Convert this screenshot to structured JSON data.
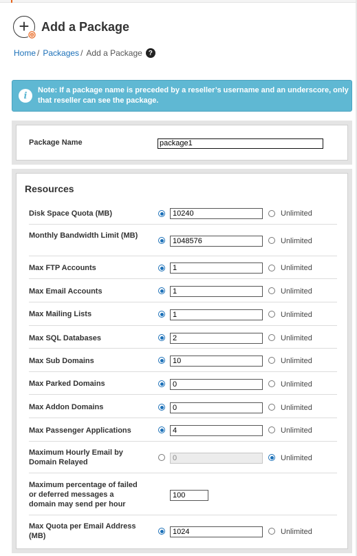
{
  "header": {
    "title": "Add a Package"
  },
  "breadcrumb": {
    "home": "Home",
    "sep": "/",
    "packages": "Packages",
    "current": "Add a Package",
    "help_glyph": "?"
  },
  "note": {
    "text": "Note: If a package name is preceded by a reseller’s username and an underscore, only that reseller can see the package."
  },
  "package": {
    "label": "Package Name",
    "value": "package1"
  },
  "resources": {
    "title": "Resources",
    "rows": [
      {
        "label": "Disk Space Quota (MB)",
        "value": "10240",
        "unlimited_label": "Unlimited",
        "selected": "value"
      },
      {
        "label": "Monthly Bandwidth Limit (MB)",
        "value": "1048576",
        "unlimited_label": "Unlimited",
        "selected": "value"
      },
      {
        "label": "Max FTP Accounts",
        "value": "1",
        "unlimited_label": "Unlimited",
        "selected": "value"
      },
      {
        "label": "Max Email Accounts",
        "value": "1",
        "unlimited_label": "Unlimited",
        "selected": "value"
      },
      {
        "label": "Max Mailing Lists",
        "value": "1",
        "unlimited_label": "Unlimited",
        "selected": "value"
      },
      {
        "label": "Max SQL Databases",
        "value": "2",
        "unlimited_label": "Unlimited",
        "selected": "value"
      },
      {
        "label": "Max Sub Domains",
        "value": "10",
        "unlimited_label": "Unlimited",
        "selected": "value"
      },
      {
        "label": "Max Parked Domains",
        "value": "0",
        "unlimited_label": "Unlimited",
        "selected": "value"
      },
      {
        "label": "Max Addon Domains",
        "value": "0",
        "unlimited_label": "Unlimited",
        "selected": "value"
      },
      {
        "label": "Max Passenger Applications",
        "value": "4",
        "unlimited_label": "Unlimited",
        "selected": "value"
      },
      {
        "label": "Maximum Hourly Email by Domain Relayed",
        "value": "0",
        "unlimited_label": "Unlimited",
        "selected": "unlimited"
      },
      {
        "label": "Maximum percentage of failed or deferred messages a domain may send per hour",
        "value": "100"
      },
      {
        "label": "Max Quota per Email Address (MB)",
        "value": "1024",
        "unlimited_label": "Unlimited",
        "selected": "value"
      }
    ]
  },
  "colors": {
    "accent": "#1b70b8",
    "note_bg": "#5fb8d3"
  }
}
